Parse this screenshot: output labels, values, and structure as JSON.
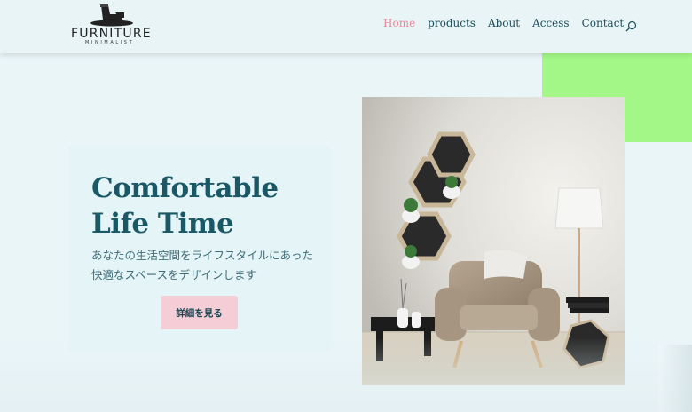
{
  "brand": {
    "name": "FURNITURE",
    "tagline": "MINIMALIST"
  },
  "nav": {
    "items": [
      {
        "label": "Home"
      },
      {
        "label": "products"
      },
      {
        "label": "About"
      },
      {
        "label": "Access"
      },
      {
        "label": "Contact"
      }
    ],
    "active": "Home",
    "search_icon": "search-icon"
  },
  "hero": {
    "title": "Comfortable Life Time",
    "text_line1": "あなたの生活空間をライフスタイルにあった",
    "text_line2": "快適なスペースをデザインします",
    "cta_label": "詳細を見る"
  },
  "colors": {
    "accent_green": "#a3f787",
    "accent_pink": "#f5cdd6",
    "active_nav": "#e88a9b",
    "primary_text": "#1a5866"
  }
}
